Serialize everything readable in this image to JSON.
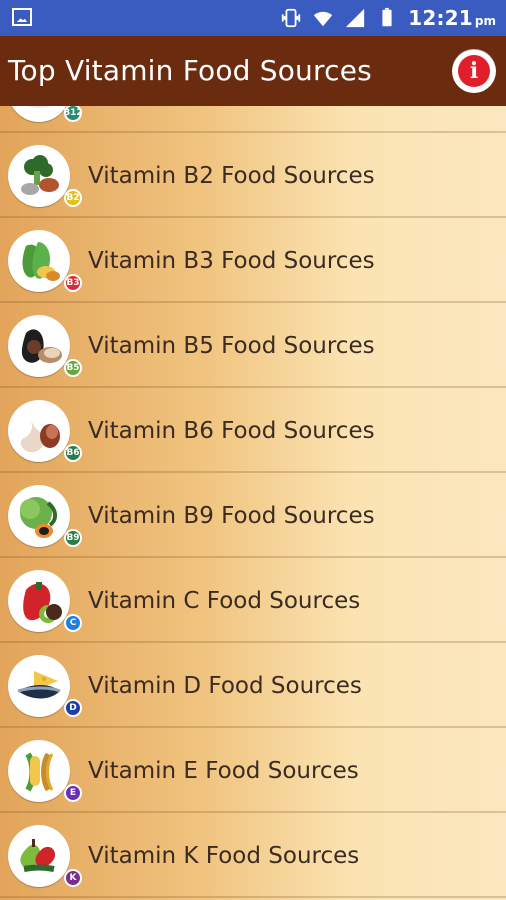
{
  "status": {
    "time": "12:21",
    "ampm": "pm"
  },
  "appbar": {
    "title": "Top Vitamin Food Sources"
  },
  "items": [
    {
      "label": "",
      "badge": "B12",
      "badgeColor": "#2a8b6c"
    },
    {
      "label": "Vitamin B2 Food Sources",
      "badge": "B2",
      "badgeColor": "#e0c21a"
    },
    {
      "label": "Vitamin B3 Food Sources",
      "badge": "B3",
      "badgeColor": "#d62b3a"
    },
    {
      "label": "Vitamin B5 Food Sources",
      "badge": "B5",
      "badgeColor": "#63a83f"
    },
    {
      "label": "Vitamin B6 Food Sources",
      "badge": "B6",
      "badgeColor": "#2a7c49"
    },
    {
      "label": "Vitamin B9 Food Sources",
      "badge": "B9",
      "badgeColor": "#2a7c49"
    },
    {
      "label": "Vitamin C Food Sources",
      "badge": "C",
      "badgeColor": "#1f7fe0"
    },
    {
      "label": "Vitamin D Food Sources",
      "badge": "D",
      "badgeColor": "#1b3ea3"
    },
    {
      "label": "Vitamin E Food Sources",
      "badge": "E",
      "badgeColor": "#6a2fb5"
    },
    {
      "label": "Vitamin K Food Sources",
      "badge": "K",
      "badgeColor": "#7b2e8b"
    }
  ]
}
